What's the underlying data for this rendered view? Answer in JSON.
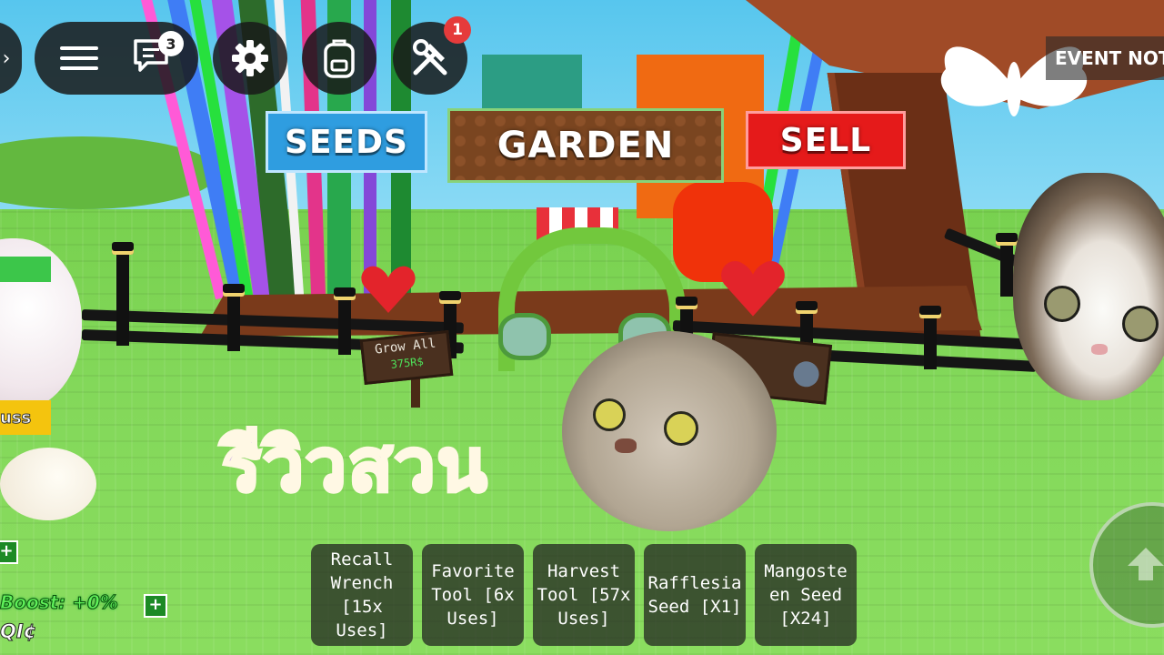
{
  "top_bar": {
    "chat_badge": "3",
    "tools_badge": "1",
    "event_label": "EVENT NOT"
  },
  "menu": {
    "seeds": "SEEDS",
    "garden": "GARDEN",
    "sell": "SELL"
  },
  "signs": {
    "grow_all_title": "Grow All",
    "grow_all_price": "375R$"
  },
  "overlay_title": "รีวิวสวน",
  "hotbar": [
    "Recall Wrench [15x Uses]",
    "Favorite Tool [6x Uses]",
    "Harvest Tool [57x Uses]",
    "Rafflesia Seed [X1]",
    "Mangosteen Seed [X24]"
  ],
  "hotbar_lines": [
    [
      "Recall",
      "Wrench",
      "[15x Uses]"
    ],
    [
      "Favorite",
      "Tool [6x",
      "Uses]"
    ],
    [
      "Harvest",
      "Tool [57x",
      "Uses]"
    ],
    [
      "Rafflesia",
      "Seed [X1]"
    ],
    [
      "Mangoste",
      "en Seed",
      "[X24]"
    ]
  ],
  "left_panel": {
    "boost": "Boost: +0%",
    "currency": "QI¢",
    "plus": "+",
    "label_fragment": "uss"
  },
  "colors": {
    "seeds": "#2f9de0",
    "garden": "#7a4520",
    "sell": "#e51a1a",
    "grass": "#83d85a",
    "title_purple": "#cba9e6"
  }
}
